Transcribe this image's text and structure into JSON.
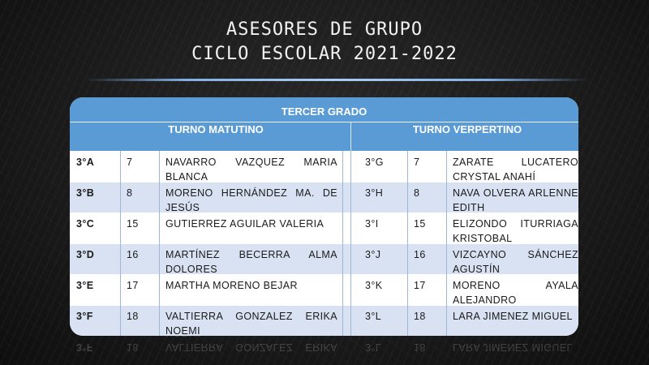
{
  "title": {
    "line1": "ASESORES DE GRUPO",
    "line2": "CICLO ESCOLAR 2021-2022"
  },
  "table": {
    "grade": "TERCER GRADO",
    "shift_morning": "TURNO MATUTINO",
    "shift_evening": "TURNO VERPERTINO",
    "rows": [
      {
        "g1": "3°A",
        "n1": "7",
        "t1": "NAVARRO VAZQUEZ MARIA BLANCA",
        "g2": "3°G",
        "n2": "7",
        "t2": "ZARATE LUCATERO CRYSTAL ANAHÍ"
      },
      {
        "g1": "3°B",
        "n1": "8",
        "t1": "MORENO HERNÁNDEZ MA. DE JESÚS",
        "g2": "3°H",
        "n2": "8",
        "t2": "NAVA OLVERA ARLENNE EDITH"
      },
      {
        "g1": "3°C",
        "n1": "15",
        "t1": "GUTIERREZ AGUILAR VALERIA",
        "g2": "3°I",
        "n2": "15",
        "t2": "ELIZONDO ITURRIAGA KRISTOBAL"
      },
      {
        "g1": "3°D",
        "n1": "16",
        "t1": "MARTÍNEZ BECERRA ALMA DOLORES",
        "g2": "3°J",
        "n2": "16",
        "t2": "VIZCAYNO SÁNCHEZ AGUSTÍN"
      },
      {
        "g1": "3°E",
        "n1": "17",
        "t1": "MARTHA MORENO BEJAR",
        "g2": "3°K",
        "n2": "17",
        "t2": "MORENO AYALA ALEJANDRO"
      },
      {
        "g1": "3°F",
        "n1": "18",
        "t1": "VALTIERRA GONZALEZ ERIKA NOEMI",
        "g2": "3°L",
        "n2": "18",
        "t2": "LARA JIMENEZ MIGUEL"
      }
    ]
  },
  "colors": {
    "header": "#5b9bd5",
    "band": "#d9e2f3",
    "background": "#1b1b1b"
  }
}
